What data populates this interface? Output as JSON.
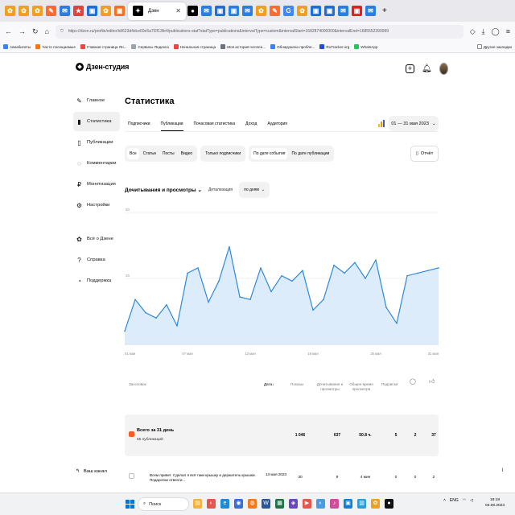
{
  "browser": {
    "tab_title": "Дзен",
    "url": "https://dzen.ru/profile/editor/id/623d4dce60e5a7f2f13fe4/publications-stat?statType=publications&intervalType=custom&intervalStart=1682874000000&intervalEnd=1685552399999",
    "tab_favicons": [
      {
        "letter": "✿",
        "color": "#f0a020"
      },
      {
        "letter": "✿",
        "color": "#f0a020"
      },
      {
        "letter": "✿",
        "color": "#f0a020"
      },
      {
        "letter": "✎",
        "color": "#ff6b2c"
      },
      {
        "letter": "✉",
        "color": "#2a7de1"
      },
      {
        "letter": "★",
        "color": "#e0423c"
      },
      {
        "letter": "▣",
        "color": "#1e6fd9"
      },
      {
        "letter": "✿",
        "color": "#f0a020"
      },
      {
        "letter": "▣",
        "color": "#f27022"
      },
      {
        "letter": "●",
        "color": "#000000"
      },
      {
        "letter": "✉",
        "color": "#2a7de1"
      },
      {
        "letter": "▣",
        "color": "#1e6fd9"
      },
      {
        "letter": "▣",
        "color": "#2a7de1"
      },
      {
        "letter": "✉",
        "color": "#2a7de1"
      },
      {
        "letter": "✿",
        "color": "#f0a020"
      },
      {
        "letter": "✎",
        "color": "#ff6b2c"
      },
      {
        "letter": "G",
        "color": "#4285f4"
      },
      {
        "letter": "✿",
        "color": "#f0a020"
      },
      {
        "letter": "▣",
        "color": "#1e6fd9"
      },
      {
        "letter": "▣",
        "color": "#1e6fd9"
      },
      {
        "letter": "✉",
        "color": "#2a7de1"
      },
      {
        "letter": "▣",
        "color": "#e02020"
      },
      {
        "letter": "✉",
        "color": "#2a7de1"
      }
    ]
  },
  "bookmarks": {
    "items": [
      "Авиабилеты",
      "Часто посещаемые",
      "Главная страница Ян...",
      "Сервисы Яндекса",
      "Начальная страница",
      "Моя история-челлен...",
      "Обнаружена пробле...",
      "RuTracker.org",
      "WhatsApp"
    ],
    "colors": [
      "#3b82f6",
      "#f97316",
      "#ef4444",
      "#9ca3af",
      "#ef4444",
      "#6b7280",
      "#3b82f6",
      "#1d4ed8",
      "#22c55e"
    ],
    "other": "Другие закладки"
  },
  "header": {
    "logo": "Дзен-студия"
  },
  "sidebar": {
    "items": [
      {
        "label": "Главное",
        "icon": "✎"
      },
      {
        "label": "Статистика",
        "icon": "▮"
      },
      {
        "label": "Публикации",
        "icon": "▯"
      },
      {
        "label": "Комментарии",
        "icon": "◌"
      },
      {
        "label": "Монетизация",
        "icon": "₽"
      },
      {
        "label": "Настройки",
        "icon": "⚙"
      }
    ],
    "secondary": [
      {
        "label": "Всё о Дзене",
        "icon": "✿"
      },
      {
        "label": "Справка",
        "icon": "?"
      },
      {
        "label": "Поддержка",
        "icon": "◔"
      }
    ],
    "back": "Ваш канал"
  },
  "page": {
    "title": "Статистика",
    "tabs": [
      "Подписчики",
      "Публикации",
      "Почасовая статистика",
      "Доход",
      "Аудитория"
    ],
    "date_range": "01 — 31 мая 2023",
    "filters_type": [
      "Все",
      "Статьи",
      "Посты",
      "Видео"
    ],
    "filter_subs": "Только подписчики",
    "filters_date": [
      "По дате события",
      "По дате публикации"
    ],
    "report": "Отчёт",
    "metric": "Дочитывания и просмотры",
    "detail_label": "Детализация",
    "detail_value": "по дням"
  },
  "chart_data": {
    "type": "area",
    "x": [
      "01.05",
      "02.05",
      "03.05",
      "04.05",
      "05.05",
      "06.05",
      "07.05",
      "08.05",
      "09.05",
      "10.05",
      "11.05",
      "12.05",
      "13.05",
      "14.05",
      "15.05",
      "16.05",
      "17.05",
      "18.05",
      "19.05",
      "20.05",
      "21.05",
      "22.05",
      "23.05",
      "24.05",
      "25.05",
      "26.05",
      "27.05",
      "28.05",
      "29.05",
      "30.05",
      "31.05"
    ],
    "x_tick_labels": [
      "01 мая",
      "07 мая",
      "13 мая",
      "19 мая",
      "25 мая",
      "31 мая"
    ],
    "y_tick_labels": [
      "0",
      "25",
      "50"
    ],
    "ylim": [
      0,
      50
    ],
    "series": [
      {
        "values": [
          5,
          17,
          12,
          10,
          15,
          7,
          27,
          29,
          16,
          24,
          37,
          18,
          17,
          29,
          20,
          26,
          24,
          28,
          13,
          17,
          30,
          27,
          31,
          25,
          32,
          14,
          8,
          26,
          27,
          28,
          29
        ]
      }
    ]
  },
  "table": {
    "headers": [
      "Заголовок",
      "Дата",
      "Показы",
      "Дочитывания и просмотры",
      "Общее время просмотра",
      "Подписки"
    ],
    "total": {
      "title": "Всего за 31 день",
      "subtitle": "65 публикаций",
      "values": [
        "1 046",
        "637",
        "50.8 ч.",
        "5",
        "2",
        "37"
      ]
    },
    "rows": [
      {
        "title": "Всем привет. Сделал я всё таки крышку и держатель крышки. Подарочки отвезти...",
        "date": "13 мая 2023",
        "values": [
          "30",
          "9",
          "4 мин",
          "0",
          "0",
          "2"
        ]
      }
    ]
  },
  "taskbar": {
    "search": "Поиск",
    "apps": [
      {
        "letter": "▤",
        "color": "#f3b23b"
      },
      {
        "letter": "◐",
        "color": "#e8554c"
      },
      {
        "letter": "e",
        "color": "#1f8ad8"
      },
      {
        "letter": "◉",
        "color": "#3a6fd8"
      },
      {
        "letter": "◍",
        "color": "#f07a1c"
      },
      {
        "letter": "W",
        "color": "#2b579a"
      },
      {
        "letter": "▦",
        "color": "#217346"
      },
      {
        "letter": "◈",
        "color": "#6b46c1"
      },
      {
        "letter": "▶",
        "color": "#e8554c"
      },
      {
        "letter": "◐",
        "color": "#4b9be0"
      },
      {
        "letter": "♪",
        "color": "#d04d9a"
      },
      {
        "letter": "▣",
        "color": "#0f7fd8"
      },
      {
        "letter": "▥",
        "color": "#2a9fd6"
      },
      {
        "letter": "✿",
        "color": "#f0a020"
      },
      {
        "letter": "●",
        "color": "#111111"
      }
    ],
    "lang": "ENG",
    "time": "18:18",
    "date": "03.06.2023"
  }
}
